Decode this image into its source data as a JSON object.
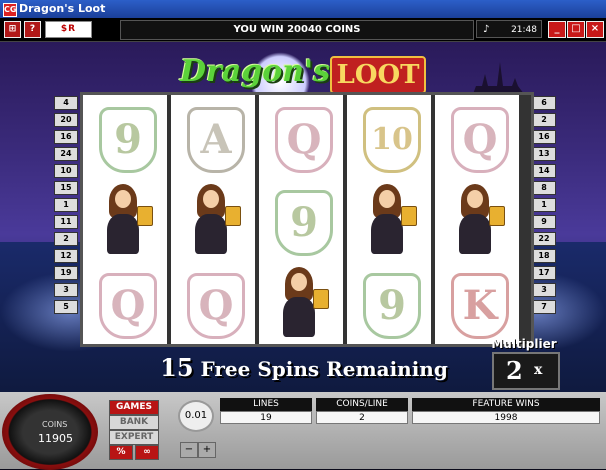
{
  "window": {
    "title": "Dragon's Loot",
    "app_icon": "CG"
  },
  "topbar": {
    "message": "YOU WIN 20040 COINS",
    "clock": "21:48",
    "left_buttons": [
      "exit-icon",
      "help-icon"
    ],
    "icon_strip": "$R",
    "window_buttons": [
      "_",
      "□",
      "×"
    ]
  },
  "logo": {
    "part1": "Dragon's",
    "part2": "LOOT"
  },
  "paylines": {
    "left": [
      "4",
      "20",
      "16",
      "24",
      "10",
      "15",
      "1",
      "11",
      "2",
      "12",
      "19",
      "3",
      "5"
    ],
    "right": [
      "6",
      "2",
      "16",
      "13",
      "14",
      "8",
      "1",
      "9",
      "22",
      "18",
      "17",
      "3",
      "7"
    ]
  },
  "reels": [
    [
      "9",
      "girl",
      "Q"
    ],
    [
      "A",
      "girl",
      "Q"
    ],
    [
      "Q",
      "9",
      "girl"
    ],
    [
      "10",
      "girl",
      "9"
    ],
    [
      "Q",
      "girl",
      "K"
    ]
  ],
  "free_spins": {
    "count": "15",
    "text": "Free Spins Remaining"
  },
  "multiplier": {
    "label": "Multiplier",
    "value": "2",
    "suffix": "x"
  },
  "bottom": {
    "coins_label": "COINS",
    "coins_value": "11905",
    "menu": [
      "GAMES",
      "BANK",
      "EXPERT"
    ],
    "mini_buttons": [
      "%",
      "∞"
    ],
    "coin_size": "0.01",
    "lines_label": "LINES",
    "lines_value": "19",
    "coinsline_label": "COINS/LINE",
    "coinsline_value": "2",
    "feature_label": "FEATURE WINS",
    "feature_value": "1998"
  },
  "colors": {
    "accent": "#b81414",
    "scene": "#3a2a7a"
  }
}
